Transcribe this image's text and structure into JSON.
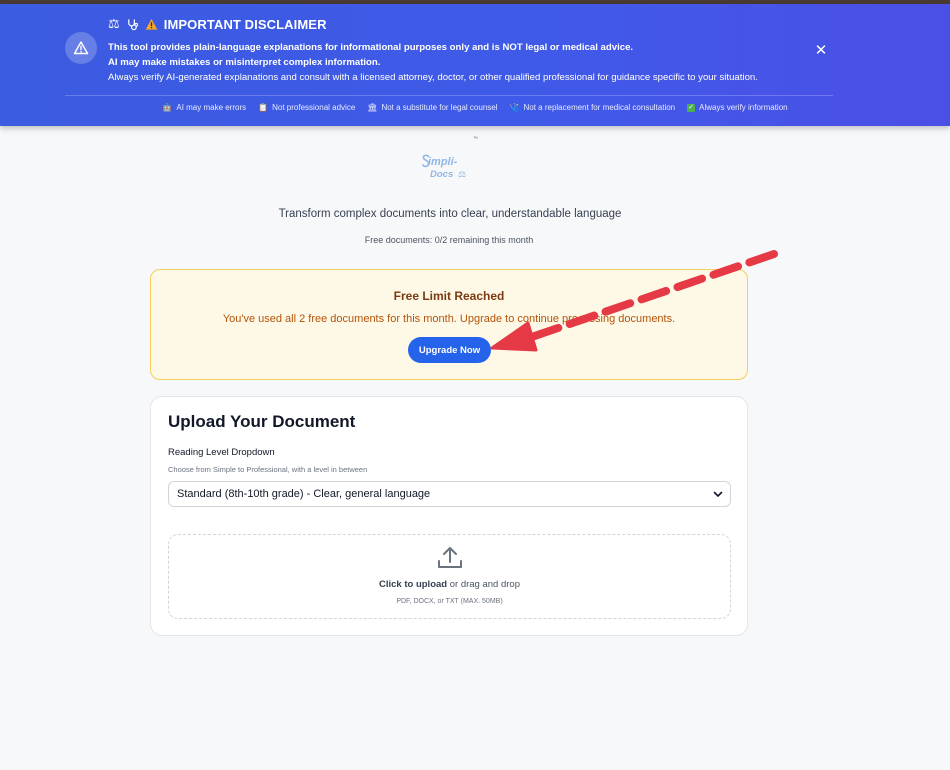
{
  "banner": {
    "title": "IMPORTANT DISCLAIMER",
    "line1": "This tool provides plain-language explanations for informational purposes only and is NOT legal or medical advice.",
    "line2": "AI may make mistakes or misinterpret complex information.",
    "line3": "Always verify AI-generated explanations and consult with a licensed attorney, doctor, or other qualified professional for guidance specific to your situation.",
    "chips": [
      {
        "icon": "robot-icon",
        "label": "AI may make errors"
      },
      {
        "icon": "clipboard-icon",
        "label": "Not professional advice"
      },
      {
        "icon": "courthouse-icon",
        "label": "Not a substitute for legal counsel"
      },
      {
        "icon": "stethoscope-icon",
        "label": "Not a replacement for medical consultation"
      },
      {
        "icon": "checkmark-icon",
        "label": "Always verify information"
      }
    ]
  },
  "logo": {
    "tm": "™",
    "line1": "impli-",
    "line2": "Docs"
  },
  "hero": {
    "tagline": "Transform complex documents into clear, understandable language",
    "quota": "Free documents: 0/2 remaining this month"
  },
  "limit": {
    "title": "Free Limit Reached",
    "text": "You've used all 2 free documents for this month. Upgrade to continue processing documents.",
    "button": "Upgrade Now"
  },
  "upload": {
    "title": "Upload Your Document",
    "reading_label": "Reading Level Dropdown",
    "reading_help": "Choose from Simple to Professional, with a level in between",
    "reading_value": "Standard (8th-10th grade) - Clear, general language",
    "drop_click": "Click to upload",
    "drop_rest": " or drag and drop",
    "drop_sub": "PDF, DOCX, or TXT (MAX. 50MB)"
  },
  "colors": {
    "banner": "#3f5ae8",
    "accent": "#2563eb",
    "warning_bg": "#fef9e7",
    "warning_border": "#f5cf5a",
    "annotation_arrow": "#e63946"
  }
}
